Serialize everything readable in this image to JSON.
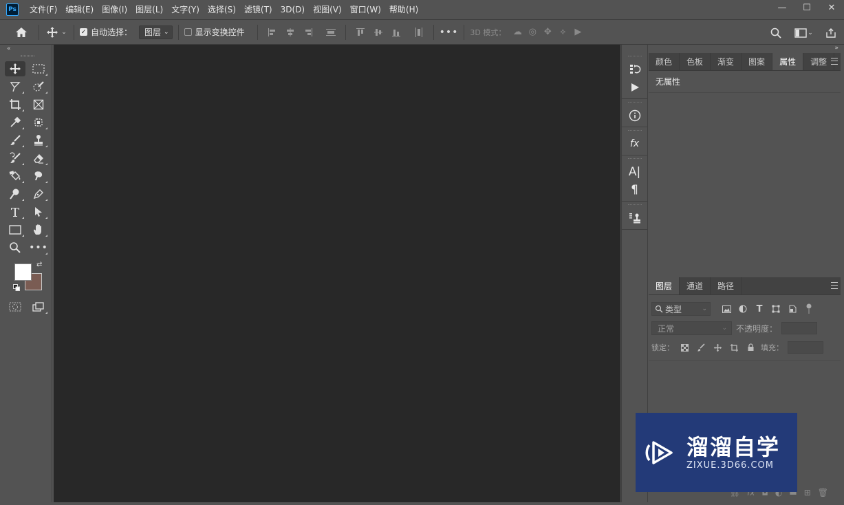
{
  "app": {
    "logo_text": "Ps"
  },
  "menubar": {
    "items": [
      "文件(F)",
      "编辑(E)",
      "图像(I)",
      "图层(L)",
      "文字(Y)",
      "选择(S)",
      "滤镜(T)",
      "3D(D)",
      "视图(V)",
      "窗口(W)",
      "帮助(H)"
    ]
  },
  "window_controls": {
    "minimize": "—",
    "maximize": "☐",
    "close": "✕"
  },
  "options_bar": {
    "auto_select_label": "自动选择：",
    "auto_select_checked": true,
    "auto_select_target": "图层",
    "show_transform_label": "显示变换控件",
    "show_transform_checked": false,
    "mode_3d_label": "3D 模式："
  },
  "toolbox": {
    "collapse_label": "«",
    "foreground_color": "#ffffff",
    "background_color": "#7a5c53"
  },
  "right_collapse": {
    "left": "«",
    "right": "»"
  },
  "properties_panel": {
    "tabs": [
      "颜色",
      "色板",
      "渐变",
      "图案",
      "属性",
      "调整"
    ],
    "active_tab": "属性",
    "title": "无属性"
  },
  "layers_panel": {
    "tabs": [
      "图层",
      "通道",
      "路径"
    ],
    "active_tab": "图层",
    "filter_placeholder": "类型",
    "blend_mode": "正常",
    "opacity_label": "不透明度：",
    "lock_label": "锁定：",
    "fill_label": "填充："
  },
  "watermark": {
    "title": "溜溜自学",
    "url": "ZIXUE.3D66.COM"
  }
}
